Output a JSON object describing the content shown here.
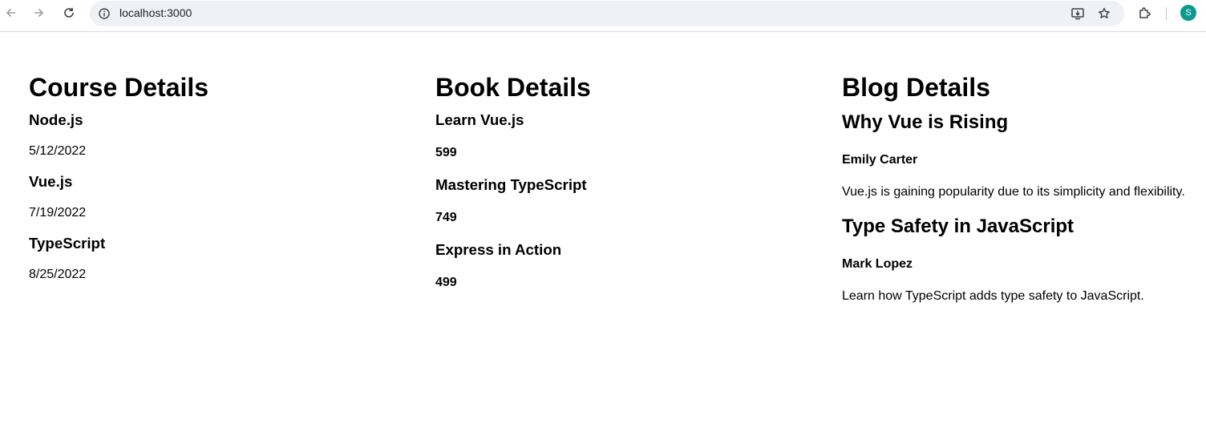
{
  "browser": {
    "url": "localhost:3000",
    "avatar_letter": "S",
    "avatar_color": "#0b9a8d",
    "icons": [
      "back-icon",
      "forward-icon",
      "reload-icon",
      "site-info-icon",
      "install-app-icon",
      "bookmark-star-icon",
      "extensions-icon"
    ]
  },
  "courses": {
    "heading": "Course Details",
    "items": [
      {
        "name": "Node.js",
        "date": "5/12/2022"
      },
      {
        "name": "Vue.js",
        "date": "7/19/2022"
      },
      {
        "name": "TypeScript",
        "date": "8/25/2022"
      }
    ]
  },
  "books": {
    "heading": "Book Details",
    "items": [
      {
        "title": "Learn Vue.js",
        "price": "599"
      },
      {
        "title": "Mastering TypeScript",
        "price": "749"
      },
      {
        "title": "Express in Action",
        "price": "499"
      }
    ]
  },
  "blogs": {
    "heading": "Blog Details",
    "items": [
      {
        "title": "Why Vue is Rising",
        "author": "Emily Carter",
        "description": "Vue.js is gaining popularity due to its simplicity and flexibility."
      },
      {
        "title": "Type Safety in JavaScript",
        "author": "Mark Lopez",
        "description": "Learn how TypeScript adds type safety to JavaScript."
      }
    ]
  }
}
